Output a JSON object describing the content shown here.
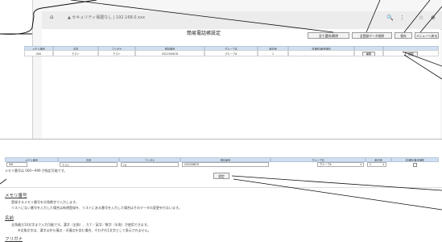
{
  "browser": {
    "url": "▲ セキュリティ保護なし | 192.168.0.xxx",
    "icons": {
      "home": "⌂",
      "search": "🔍",
      "more": "⋮",
      "star": "☆",
      "profile": "⊕"
    }
  },
  "page": {
    "title": "簡易電話帳設定"
  },
  "toolbar": {
    "select_all": "全て選択/解除",
    "delete_all": "全登録データ削除",
    "save": "保存",
    "menu_back": "メニューへ戻る"
  },
  "list_table": {
    "headers": [
      "メモリ番号",
      "名前",
      "フリガナ",
      "電話番号",
      "グループ名",
      "着信音",
      "非通知/番号通知",
      "",
      ""
    ],
    "rows": [
      {
        "cells": [
          "000",
          "テスト",
          "テスト",
          "0312345678",
          "グループA",
          "1",
          "-"
        ],
        "edit": "編集",
        "delete": "削除"
      }
    ]
  },
  "edit_form": {
    "headers": [
      "メモリ番号",
      "名前",
      "フリガナ",
      "電話番号",
      "グループ名",
      "着信音",
      "非通知/番号通知"
    ],
    "values": {
      "memory_no": "000",
      "name": "テスト",
      "kana": "ﾃｽﾄ",
      "phone": "0312345678",
      "group": "グループA",
      "ringtone": "1"
    },
    "note": "メモリ番号は 000〜999 が指定可能です。",
    "set_button": "設定"
  },
  "help": {
    "memory_title": "メモリ番号",
    "memory_lines": [
      "登録するメモリ番号を半角数字で入力します。",
      "リストにない番号を入力した場合は新規登録を、リストにある番号を入力した場合はそのデータの変更を行ないます。"
    ],
    "name_title": "名前",
    "name_lines": [
      "全角最大10文字まで入力可能です。漢字（全角）、カナ／英字／数字（半角）が使用できます。",
      "※全角文字は、漢字以外も濁点・半濁点を含む場合、それぞれ1文字として表示されません。"
    ],
    "kana_title": "フリガナ"
  }
}
